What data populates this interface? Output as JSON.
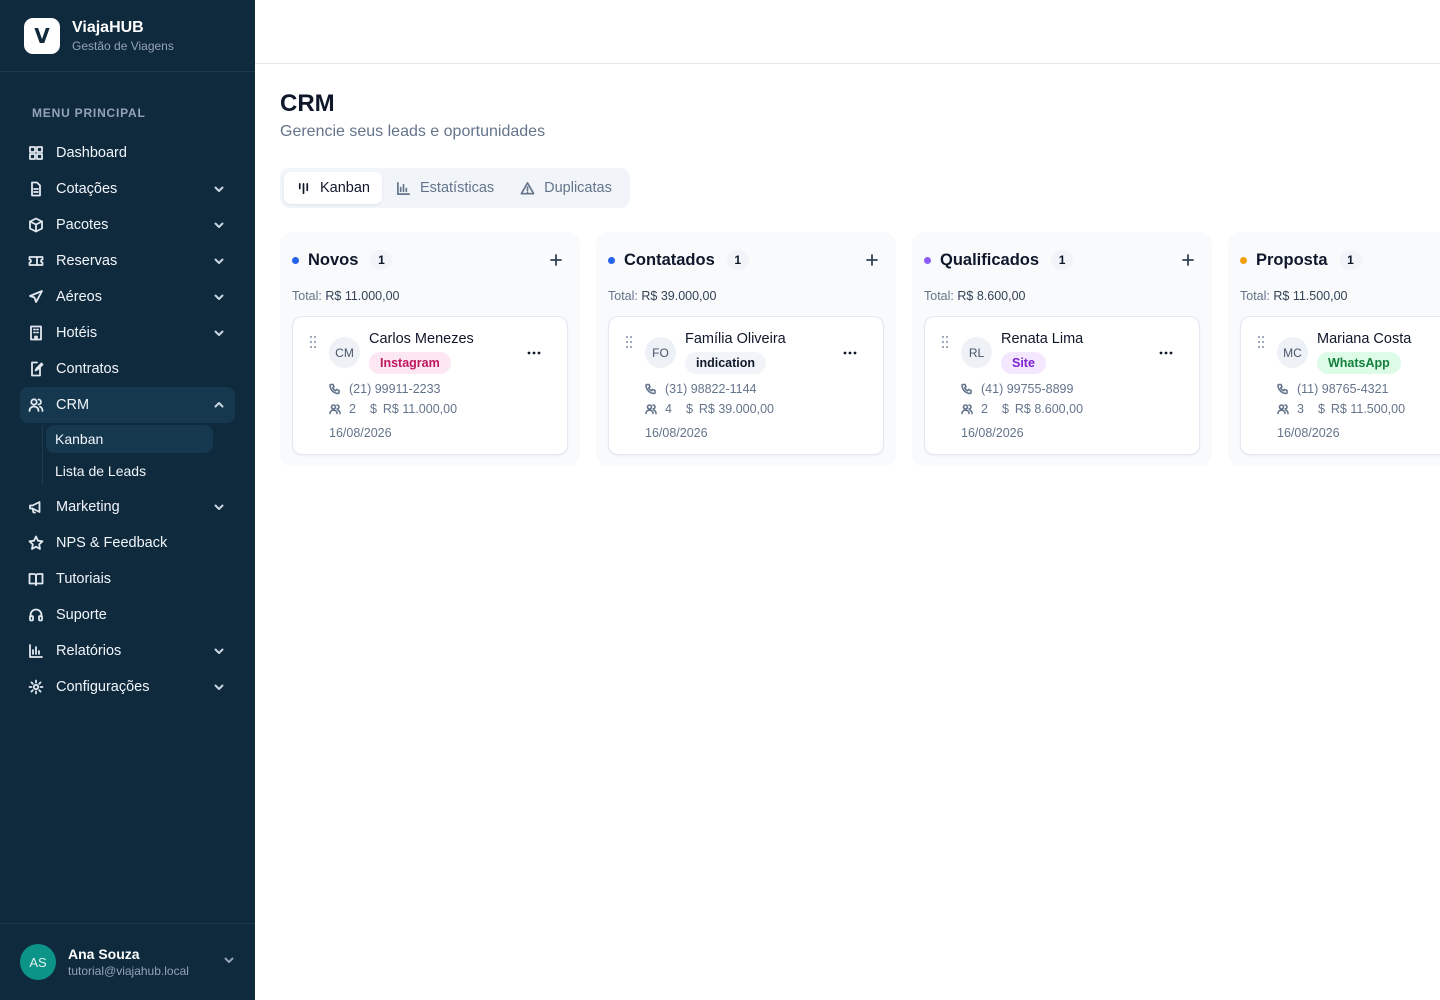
{
  "brand": {
    "name": "ViajaHUB",
    "subtitle": "Gestão de Viagens",
    "logo_letter": "V"
  },
  "sidebar": {
    "heading": "MENU PRINCIPAL",
    "items": [
      {
        "label": "Dashboard",
        "icon": "dashboard-icon",
        "expandable": false
      },
      {
        "label": "Cotações",
        "icon": "file-text-icon",
        "expandable": true
      },
      {
        "label": "Pacotes",
        "icon": "package-icon",
        "expandable": true
      },
      {
        "label": "Reservas",
        "icon": "ticket-icon",
        "expandable": true
      },
      {
        "label": "Aéreos",
        "icon": "plane-icon",
        "expandable": true
      },
      {
        "label": "Hotéis",
        "icon": "building-icon",
        "expandable": true
      },
      {
        "label": "Contratos",
        "icon": "file-edit-icon",
        "expandable": false
      },
      {
        "label": "CRM",
        "icon": "users-icon",
        "expandable": true,
        "expanded": true
      },
      {
        "label": "Marketing",
        "icon": "megaphone-icon",
        "expandable": true
      },
      {
        "label": "NPS & Feedback",
        "icon": "star-icon",
        "expandable": false
      },
      {
        "label": "Tutoriais",
        "icon": "book-open-icon",
        "expandable": false
      },
      {
        "label": "Suporte",
        "icon": "headset-icon",
        "expandable": false
      },
      {
        "label": "Relatórios",
        "icon": "bar-chart-icon",
        "expandable": true
      },
      {
        "label": "Configurações",
        "icon": "gear-icon",
        "expandable": true
      }
    ],
    "crm_submenu": [
      {
        "label": "Kanban",
        "active": true
      },
      {
        "label": "Lista de Leads",
        "active": false
      }
    ]
  },
  "user": {
    "initials": "AS",
    "name": "Ana Souza",
    "email": "tutorial@viajahub.local"
  },
  "page": {
    "title": "CRM",
    "subtitle": "Gerencie seus leads e oportunidades"
  },
  "tabs": [
    {
      "label": "Kanban",
      "icon": "kanban-icon",
      "active": true
    },
    {
      "label": "Estatísticas",
      "icon": "bar-chart-icon",
      "active": false
    },
    {
      "label": "Duplicatas",
      "icon": "alert-triangle-icon",
      "active": false
    }
  ],
  "columns": [
    {
      "title": "Novos",
      "count": "1",
      "color": "#2563eb",
      "total_label": "Total:",
      "total_value": "R$ 11.000,00",
      "card": {
        "initials": "CM",
        "name": "Carlos Menezes",
        "source": "Instagram",
        "badge_bg": "#fce7f3",
        "badge_fg": "#be185d",
        "phone": "(21) 99911-2233",
        "people": "2",
        "value": "R$ 11.000,00",
        "date": "16/08/2026"
      }
    },
    {
      "title": "Contatados",
      "count": "1",
      "color": "#2563eb",
      "total_label": "Total:",
      "total_value": "R$ 39.000,00",
      "card": {
        "initials": "FO",
        "name": "Família Oliveira",
        "source": "indication",
        "badge_bg": "#f1f5f9",
        "badge_fg": "#0f172a",
        "phone": "(31) 98822-1144",
        "people": "4",
        "value": "R$ 39.000,00",
        "date": "16/08/2026"
      }
    },
    {
      "title": "Qualificados",
      "count": "1",
      "color": "#8b5cf6",
      "total_label": "Total:",
      "total_value": "R$ 8.600,00",
      "card": {
        "initials": "RL",
        "name": "Renata Lima",
        "source": "Site",
        "badge_bg": "#f3e8ff",
        "badge_fg": "#7e22ce",
        "phone": "(41) 99755-8899",
        "people": "2",
        "value": "R$ 8.600,00",
        "date": "16/08/2026"
      }
    },
    {
      "title": "Proposta",
      "count": "1",
      "color": "#f59e0b",
      "total_label": "Total:",
      "total_value": "R$ 11.500,00",
      "card": {
        "initials": "MC",
        "name": "Mariana Costa",
        "source": "WhatsApp",
        "badge_bg": "#dcfce7",
        "badge_fg": "#15803d",
        "phone": "(11) 98765-4321",
        "people": "3",
        "value": "R$ 11.500,00",
        "date": "16/08/2026"
      }
    }
  ]
}
